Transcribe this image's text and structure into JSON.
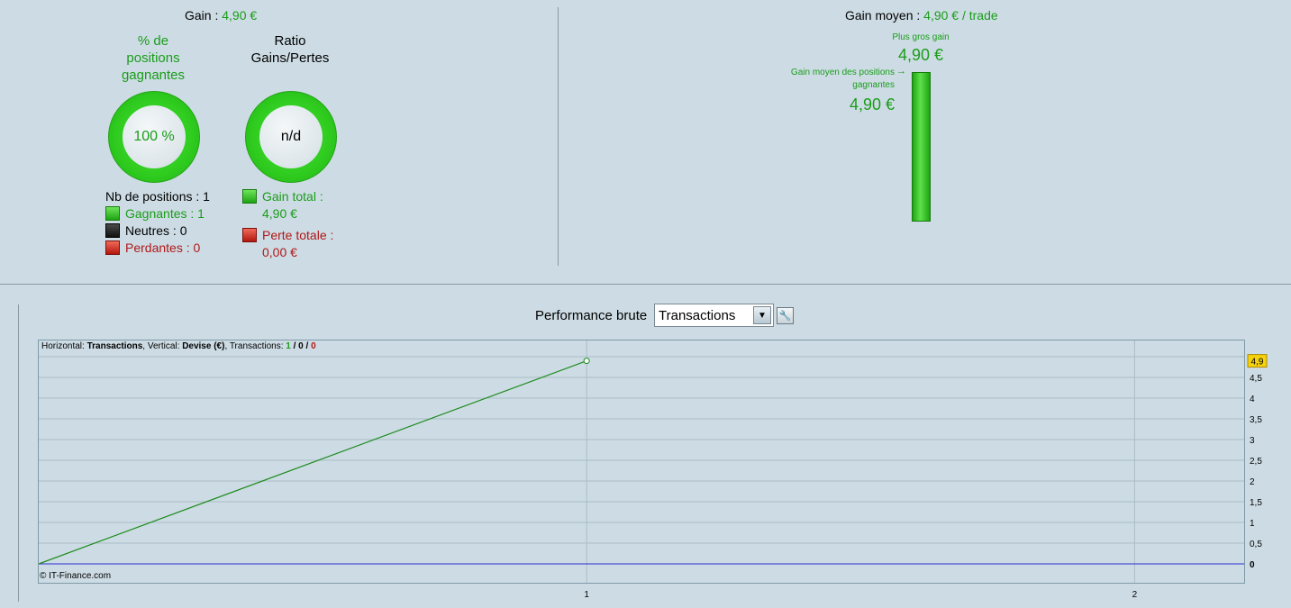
{
  "left_panel": {
    "gain_label": "Gain :",
    "gain_value": "4,90 €",
    "pct_title_line1": "% de",
    "pct_title_line2": "positions",
    "pct_title_line3": "gagnantes",
    "pct_value": "100 %",
    "ratio_title_line1": "Ratio",
    "ratio_title_line2": "Gains/Pertes",
    "ratio_value": "n/d",
    "nb_positions": "Nb de positions : 1",
    "gagnantes": "Gagnantes : 1",
    "neutres": "Neutres : 0",
    "perdantes": "Perdantes : 0",
    "gain_total_label": "Gain total :",
    "gain_total_value": "4,90 €",
    "perte_totale_label": "Perte totale :",
    "perte_totale_value": "0,00 €"
  },
  "right_panel": {
    "gain_moyen_label": "Gain moyen :",
    "gain_moyen_value": "4,90 € / trade",
    "plus_gros_gain_label": "Plus gros gain",
    "plus_gros_gain_value": "4,90 €",
    "gain_moyen_positions_line1": "Gain moyen des positions",
    "gain_moyen_positions_line2": "gagnantes",
    "gain_moyen_positions_value": "4,90 €"
  },
  "performance": {
    "label": "Performance brute",
    "selected": "Transactions",
    "dropdown_icon": "chevron-down-icon",
    "tool_icon": "wrench-icon"
  },
  "chart_info": {
    "horizontal_label": "Horizontal: ",
    "horizontal_value": "Transactions",
    "vertical_label": ", Vertical: ",
    "vertical_value": "Devise (€)",
    "transactions_label": ", Transactions: ",
    "tx_win": "1",
    "tx_sep1": " / ",
    "tx_neutral": "0",
    "tx_sep2": " / ",
    "tx_loss": "0"
  },
  "copyright": "© IT-Finance.com",
  "colors": {
    "background": "#cddce4",
    "green": "#1a9c1a",
    "red": "#b01818",
    "line": "#1e8a1e",
    "zero_line": "#2a2ad0",
    "badge": "#f5d20a"
  },
  "chart_data": {
    "type": "line",
    "x": [
      0,
      1
    ],
    "series": [
      {
        "values": [
          0,
          4.9
        ]
      }
    ],
    "xlim": [
      0,
      2.2
    ],
    "ylim": [
      0,
      5
    ],
    "x_ticks": [
      "1",
      "2"
    ],
    "y_ticks": [
      "0,5",
      "1",
      "1,5",
      "2",
      "2,5",
      "3",
      "3,5",
      "4",
      "4,5"
    ],
    "y_zero_label": "0",
    "last_value_badge": "4,9",
    "grid": true
  }
}
